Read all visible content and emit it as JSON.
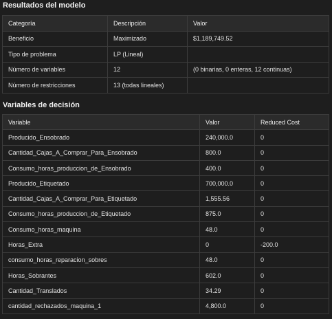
{
  "model_results": {
    "title": "Resultados del modelo",
    "headers": [
      "Categoría",
      "Descripción",
      "Valor"
    ],
    "rows": [
      [
        "Beneficio",
        "Maximizado",
        "$1,189,749.52"
      ],
      [
        "Tipo de problema",
        "LP (Lineal)",
        ""
      ],
      [
        "Número de variables",
        "12",
        "(0 binarias, 0 enteras, 12 continuas)"
      ],
      [
        "Número de restricciones",
        "13 (todas lineales)",
        ""
      ]
    ]
  },
  "decision_variables": {
    "title": "Variables de decisión",
    "headers": [
      "Variable",
      "Valor",
      "Reduced Cost"
    ],
    "rows": [
      [
        "Producido_Ensobrado",
        "240,000.0",
        "0"
      ],
      [
        "Cantidad_Cajas_A_Comprar_Para_Ensobrado",
        "800.0",
        "0"
      ],
      [
        "Consumo_horas_produccion_de_Ensobrado",
        "400.0",
        "0"
      ],
      [
        "Producido_Etiquetado",
        "700,000.0",
        "0"
      ],
      [
        "Cantidad_Cajas_A_Comprar_Para_Etiquetado",
        "1,555.56",
        "0"
      ],
      [
        "Consumo_horas_produccion_de_Etiquetado",
        "875.0",
        "0"
      ],
      [
        "Consumo_horas_maquina",
        "48.0",
        "0"
      ],
      [
        "Horas_Extra",
        "0",
        "-200.0"
      ],
      [
        "consumo_horas_reparacion_sobres",
        "48.0",
        "0"
      ],
      [
        "Horas_Sobrantes",
        "602.0",
        "0"
      ],
      [
        "Cantidad_Translados",
        "34.29",
        "0"
      ],
      [
        "cantidad_rechazados_maquina_1",
        "4,800.0",
        "0"
      ]
    ]
  }
}
